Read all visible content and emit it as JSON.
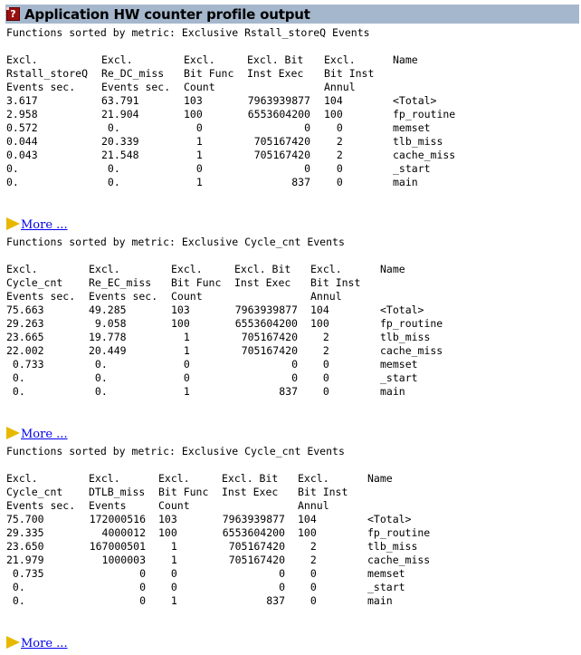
{
  "header": {
    "icon": "help-icon",
    "title": "Application HW counter profile output"
  },
  "sections": [
    {
      "caption": "Functions sorted by metric: Exclusive Rstall_storeQ Events",
      "headers": [
        [
          "Excl.",
          "Rstall_storeQ",
          "Events sec."
        ],
        [
          "Excl.",
          "Re_DC_miss",
          "Events sec."
        ],
        [
          "Excl.",
          "Bit Func",
          "Count"
        ],
        [
          "Excl. Bit",
          "Inst Exec",
          ""
        ],
        [
          "Excl.",
          "Bit Inst",
          "Annul"
        ],
        [
          "Name",
          "",
          ""
        ]
      ],
      "rows": [
        [
          "3.617",
          "63.791",
          "103",
          "7963939877",
          "104",
          "<Total>"
        ],
        [
          "2.958",
          "21.904",
          "100",
          "6553604200",
          "100",
          "fp_routine"
        ],
        [
          "0.572",
          " 0.",
          "  0",
          "0",
          "  0",
          "memset"
        ],
        [
          "0.044",
          "20.339",
          "  1",
          "705167420",
          "  2",
          "tlb_miss"
        ],
        [
          "0.043",
          "21.548",
          "  1",
          "705167420",
          "  2",
          "cache_miss"
        ],
        [
          "0.",
          " 0.",
          "  0",
          "0",
          "  0",
          "_start"
        ],
        [
          "0.",
          " 0.",
          "  1",
          "837",
          "  0",
          "main"
        ]
      ],
      "more_label": "More ..."
    },
    {
      "caption": "Functions sorted by metric: Exclusive Cycle_cnt Events",
      "headers": [
        [
          "Excl.",
          "Cycle_cnt",
          "Events sec."
        ],
        [
          "Excl.",
          "Re_EC_miss",
          "Events sec."
        ],
        [
          "Excl.",
          "Bit Func",
          "Count"
        ],
        [
          "Excl. Bit",
          "Inst Exec",
          ""
        ],
        [
          "Excl.",
          "Bit Inst",
          "Annul"
        ],
        [
          "Name",
          "",
          ""
        ]
      ],
      "rows": [
        [
          "75.663",
          "49.285",
          "103",
          "7963939877",
          "104",
          "<Total>"
        ],
        [
          "29.263",
          " 9.058",
          "100",
          "6553604200",
          "100",
          "fp_routine"
        ],
        [
          "23.665",
          "19.778",
          "  1",
          "705167420",
          "  2",
          "tlb_miss"
        ],
        [
          "22.002",
          "20.449",
          "  1",
          "705167420",
          "  2",
          "cache_miss"
        ],
        [
          " 0.733",
          " 0.",
          "  0",
          "0",
          "  0",
          "memset"
        ],
        [
          " 0.",
          " 0.",
          "  0",
          "0",
          "  0",
          "_start"
        ],
        [
          " 0.",
          " 0.",
          "  1",
          "837",
          "  0",
          "main"
        ]
      ],
      "more_label": "More ..."
    },
    {
      "caption": "Functions sorted by metric: Exclusive Cycle_cnt Events",
      "headers": [
        [
          "Excl.",
          "Cycle_cnt",
          "Events sec."
        ],
        [
          "Excl.",
          "DTLB_miss",
          "Events"
        ],
        [
          "Excl.",
          "Bit Func",
          "Count"
        ],
        [
          "Excl. Bit",
          "Inst Exec",
          ""
        ],
        [
          "Excl.",
          "Bit Inst",
          "Annul"
        ],
        [
          "Name",
          "",
          ""
        ]
      ],
      "rows": [
        [
          "75.700",
          "172000516",
          "103",
          "7963939877",
          "104",
          "<Total>"
        ],
        [
          "29.335",
          "4000012",
          "100",
          "6553604200",
          "100",
          "fp_routine"
        ],
        [
          "23.650",
          "167000501",
          "  1",
          "705167420",
          "  2",
          "tlb_miss"
        ],
        [
          "21.979",
          "1000003",
          "  1",
          "705167420",
          "  2",
          "cache_miss"
        ],
        [
          " 0.735",
          "0",
          "  0",
          "0",
          "  0",
          "memset"
        ],
        [
          " 0.",
          "0",
          "  0",
          "0",
          "  0",
          "_start"
        ],
        [
          " 0.",
          "0",
          "  1",
          "837",
          "  0",
          "main"
        ]
      ],
      "more_label": "More ..."
    }
  ]
}
